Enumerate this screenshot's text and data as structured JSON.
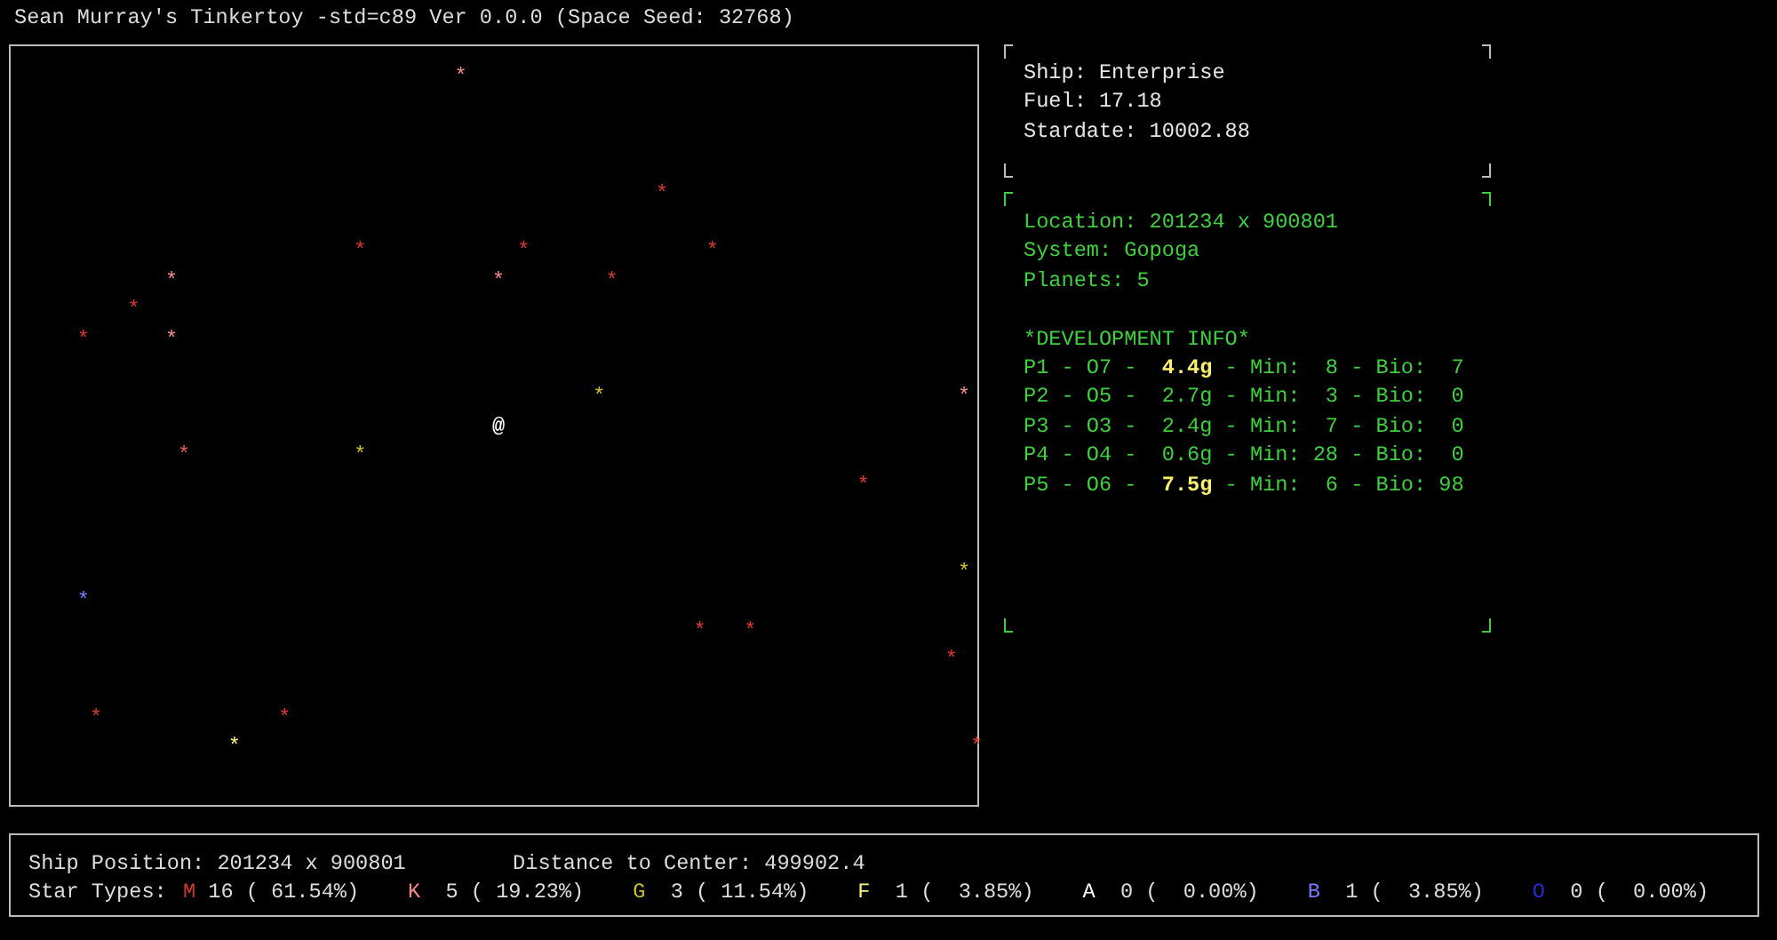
{
  "title": "Sean Murray's Tinkertoy -std=c89 Ver 0.0.0 (Space Seed: 32768)",
  "map": {
    "ship": {
      "glyph": "@"
    },
    "stars": [
      {
        "glyph": "*",
        "color": "#f08a8a"
      },
      {
        "glyph": "*",
        "color": "#d63a2e"
      },
      {
        "glyph": "*",
        "color": "#d63a2e"
      },
      {
        "glyph": "*",
        "color": "#d63a2e"
      },
      {
        "glyph": "*",
        "color": "#d63a2e"
      },
      {
        "glyph": "*",
        "color": "#f08a8a"
      },
      {
        "glyph": "*",
        "color": "#f08a8a"
      },
      {
        "glyph": "*",
        "color": "#d63a2e"
      },
      {
        "glyph": "*",
        "color": "#d63a2e"
      },
      {
        "glyph": "*",
        "color": "#d63a2e"
      },
      {
        "glyph": "*",
        "color": "#f08a8a"
      },
      {
        "glyph": "*",
        "color": "#c8c02a"
      },
      {
        "glyph": "*",
        "color": "#f08a8a"
      },
      {
        "glyph": "*",
        "color": "#e0605a"
      },
      {
        "glyph": "*",
        "color": "#c8c02a"
      },
      {
        "glyph": "*",
        "color": "#d63a2e"
      },
      {
        "glyph": "*",
        "color": "#c8c02a"
      },
      {
        "glyph": "*",
        "color": "#7a7aff"
      },
      {
        "glyph": "*",
        "color": "#d63a2e"
      },
      {
        "glyph": "*",
        "color": "#d63a2e"
      },
      {
        "glyph": "*",
        "color": "#d63a2e"
      },
      {
        "glyph": "*",
        "color": "#d63a2e"
      },
      {
        "glyph": "*",
        "color": "#d63a2e"
      },
      {
        "glyph": "*",
        "color": "#f5f07a"
      },
      {
        "glyph": "*",
        "color": "#d63a2e"
      }
    ]
  },
  "ship_panel": [
    "Ship: Enterprise",
    "Fuel: 17.18",
    "Stardate: 10002.88"
  ],
  "system_panel": {
    "lines": [
      "Location: 201234 x 900801",
      "System: Gopoga",
      "Planets: 5"
    ],
    "heading": "*DEVELOPMENT INFO*",
    "planets": [
      {
        "prefix": "P1 - O7 - ",
        "mass": " 4.4g",
        "suffix": " - Min:  8 - Bio:  7",
        "highlight": true
      },
      {
        "prefix": "P2 - O5 - ",
        "mass": " 2.7g",
        "suffix": " - Min:  3 - Bio:  0",
        "highlight": false
      },
      {
        "prefix": "P3 - O3 - ",
        "mass": " 2.4g",
        "suffix": " - Min:  7 - Bio:  0",
        "highlight": false
      },
      {
        "prefix": "P4 - O4 - ",
        "mass": " 0.6g",
        "suffix": " - Min: 28 - Bio:  0",
        "highlight": false
      },
      {
        "prefix": "P5 - O6 - ",
        "mass": " 7.5g",
        "suffix": " - Min:  6 - Bio: 98",
        "highlight": true
      }
    ]
  },
  "status": {
    "position": "Ship Position: 201234 x 900801",
    "distance": "Distance to Center: 499902.4",
    "star_types_label": "Star Types:",
    "star_types": [
      {
        "letter": "M",
        "color": "#d63a2e",
        "count": "16 ( 61.54%)"
      },
      {
        "letter": "K",
        "color": "#f08a8a",
        "count": " 5 ( 19.23%)"
      },
      {
        "letter": "G",
        "color": "#c8c02a",
        "count": " 3 ( 11.54%)"
      },
      {
        "letter": "F",
        "color": "#f5f07a",
        "count": " 1 (  3.85%)"
      },
      {
        "letter": "A",
        "color": "#ffffff",
        "count": " 0 (  0.00%)"
      },
      {
        "letter": "B",
        "color": "#7a7aff",
        "count": " 1 (  3.85%)"
      },
      {
        "letter": "O",
        "color": "#2a2ad0",
        "count": " 0 (  0.00%)"
      }
    ]
  }
}
